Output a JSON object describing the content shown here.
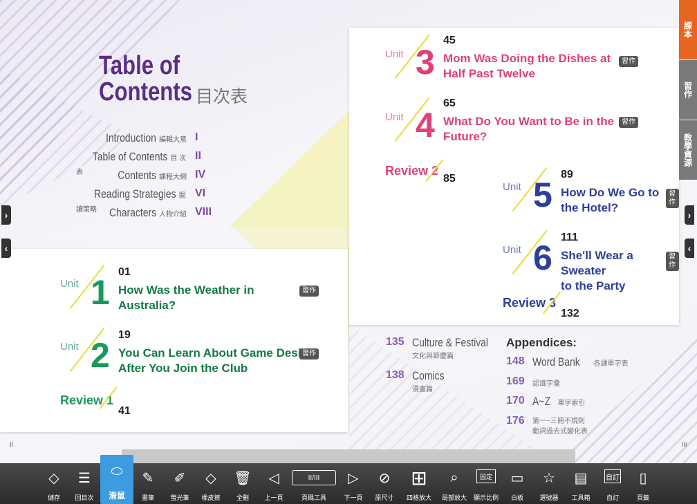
{
  "side_tabs": [
    {
      "label": "課本",
      "color": "#e8651f"
    },
    {
      "label": "習作",
      "color": "#7a7a7a"
    },
    {
      "label": "教學資源",
      "color": "#7a7a7a"
    }
  ],
  "left_page": {
    "title_line1": "Table of",
    "title_line2": "Contents",
    "title_zh": "目次表",
    "intro": [
      {
        "en": "Introduction",
        "zh": "編輯大意",
        "roman": "I"
      },
      {
        "en": "Table of Contents",
        "zh": "目 次 表",
        "roman": "II"
      },
      {
        "en": "Contents",
        "zh": "課程大綱",
        "roman": "IV"
      },
      {
        "en": "Reading Strategies",
        "zh": "閱讀策略",
        "roman": "VI"
      },
      {
        "en": "Characters",
        "zh": "人物介紹",
        "roman": "VIII"
      }
    ],
    "units": [
      {
        "label": "Unit",
        "num": "1",
        "page": "01",
        "title1": "How Was the Weather in",
        "title2": "Australia?",
        "badge": "習作"
      },
      {
        "label": "Unit",
        "num": "2",
        "page": "19",
        "title1": "You Can Learn About Game Design",
        "title2": "After You Join the Club",
        "badge": "習作"
      }
    ],
    "review": {
      "label": "Review 1",
      "page": "41"
    },
    "page_marker": "II"
  },
  "right_page": {
    "units_pink": [
      {
        "label": "Unit",
        "num": "3",
        "page": "45",
        "title1": "Mom Was Doing the Dishes at",
        "title2": "Half Past Twelve",
        "badge": "習作"
      },
      {
        "label": "Unit",
        "num": "4",
        "page": "65",
        "title1": "What Do You Want to Be in the",
        "title2": "Future?",
        "badge": "習作"
      }
    ],
    "review2": {
      "label": "Review 2",
      "page": "85"
    },
    "units_blue": [
      {
        "label": "Unit",
        "num": "5",
        "page": "89",
        "title1": "How Do We Go to",
        "title2": "the Hotel?",
        "badge": "習作"
      },
      {
        "label": "Unit",
        "num": "6",
        "page": "111",
        "title1": "She'll Wear a Sweater",
        "title2": "to the Party",
        "badge": "習作"
      }
    ],
    "review3": {
      "label": "Review 3",
      "page": "132"
    },
    "extras": [
      {
        "num": "135",
        "en": "Culture & Festival",
        "zh": "文化與節慶篇"
      },
      {
        "num": "138",
        "en": "Comics",
        "zh": "漫畫篇"
      }
    ],
    "appendices_title": "Appendices:",
    "appendices": [
      {
        "num": "148",
        "en": "Word Bank",
        "zh": "各課單字表"
      },
      {
        "num": "169",
        "en": "",
        "zh": "認識字彙"
      },
      {
        "num": "170",
        "en": "A~Z",
        "zh": "單字索引"
      },
      {
        "num": "176",
        "en": "",
        "zh": "第一~三冊不規則",
        "zh2": "動詞過去式變化表"
      }
    ],
    "page_marker": "III"
  },
  "toolbar": [
    {
      "icon": "◇",
      "label": "儲存"
    },
    {
      "icon": "☰",
      "label": "回目次"
    },
    {
      "icon": "⬭",
      "label": "滑鼠",
      "active": true
    },
    {
      "icon": "✎",
      "label": "畫筆"
    },
    {
      "icon": "✐",
      "label": "螢光筆"
    },
    {
      "icon": "◇",
      "label": "橡皮擦"
    },
    {
      "icon": "🗑",
      "label": "全刪"
    },
    {
      "icon": "◁",
      "label": "上一頁"
    },
    {
      "icon": "II/III",
      "label": "頁碼工具"
    },
    {
      "icon": "▷",
      "label": "下一頁"
    },
    {
      "icon": "⊘",
      "label": "原尺寸"
    },
    {
      "icon": "⊞",
      "label": "四格放大"
    },
    {
      "icon": "⌕",
      "label": "局部放大"
    },
    {
      "icon": "固定",
      "label": "顯示比例"
    },
    {
      "icon": "▭",
      "label": "白板"
    },
    {
      "icon": "☆",
      "label": "選號器"
    },
    {
      "icon": "▤",
      "label": "工具箱"
    },
    {
      "icon": "自訂",
      "label": "自訂"
    },
    {
      "icon": "▯",
      "label": "頁籤"
    }
  ]
}
